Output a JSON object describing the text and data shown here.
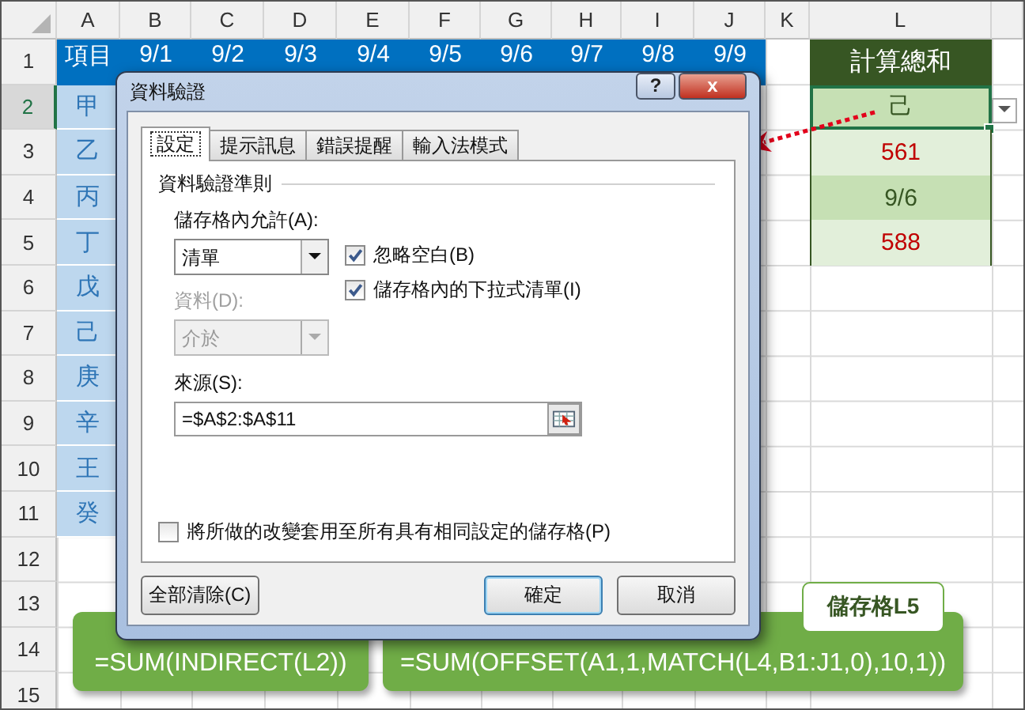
{
  "sheet": {
    "columns": [
      "A",
      "B",
      "C",
      "D",
      "E",
      "F",
      "G",
      "H",
      "I",
      "J",
      "K",
      "L"
    ],
    "rows": [
      {
        "number": "1",
        "cells": [
          {
            "text": "項目",
            "kind": "title"
          },
          {
            "text": "9/1",
            "kind": "title"
          },
          {
            "text": "9/2",
            "kind": "title"
          },
          {
            "text": "9/3",
            "kind": "title"
          },
          {
            "text": "9/4",
            "kind": "title"
          },
          {
            "text": "9/5",
            "kind": "title"
          },
          {
            "text": "9/6",
            "kind": "title"
          },
          {
            "text": "9/7",
            "kind": "title"
          },
          {
            "text": "9/8",
            "kind": "title"
          },
          {
            "text": "9/9",
            "kind": "title"
          },
          {
            "text": ""
          },
          {
            "text": "計算總和",
            "kind": "sum-title"
          }
        ]
      },
      {
        "number": "2",
        "selected": true,
        "cells": [
          {
            "text": "甲",
            "kind": "item"
          },
          {
            "text": ""
          },
          {
            "text": ""
          },
          {
            "text": ""
          },
          {
            "text": ""
          },
          {
            "text": ""
          },
          {
            "text": ""
          },
          {
            "text": ""
          },
          {
            "text": ""
          },
          {
            "text": ""
          },
          {
            "text": ""
          },
          {
            "text": "己",
            "kind": "result-dark",
            "selected": true
          }
        ]
      },
      {
        "number": "3",
        "cells": [
          {
            "text": "乙",
            "kind": "item"
          },
          {
            "text": ""
          },
          {
            "text": ""
          },
          {
            "text": ""
          },
          {
            "text": ""
          },
          {
            "text": ""
          },
          {
            "text": ""
          },
          {
            "text": ""
          },
          {
            "text": ""
          },
          {
            "text": ""
          },
          {
            "text": ""
          },
          {
            "text": "561",
            "kind": "result-red"
          }
        ]
      },
      {
        "number": "4",
        "cells": [
          {
            "text": "丙",
            "kind": "item"
          },
          {
            "text": ""
          },
          {
            "text": ""
          },
          {
            "text": ""
          },
          {
            "text": ""
          },
          {
            "text": ""
          },
          {
            "text": ""
          },
          {
            "text": ""
          },
          {
            "text": ""
          },
          {
            "text": ""
          },
          {
            "text": ""
          },
          {
            "text": "9/6",
            "kind": "result-dark"
          }
        ]
      },
      {
        "number": "5",
        "cells": [
          {
            "text": "丁",
            "kind": "item"
          },
          {
            "text": ""
          },
          {
            "text": ""
          },
          {
            "text": ""
          },
          {
            "text": ""
          },
          {
            "text": ""
          },
          {
            "text": ""
          },
          {
            "text": ""
          },
          {
            "text": ""
          },
          {
            "text": ""
          },
          {
            "text": ""
          },
          {
            "text": "588",
            "kind": "result-red"
          }
        ]
      },
      {
        "number": "6",
        "cells": [
          {
            "text": "戊",
            "kind": "item"
          }
        ]
      },
      {
        "number": "7",
        "cells": [
          {
            "text": "己",
            "kind": "item"
          }
        ]
      },
      {
        "number": "8",
        "cells": [
          {
            "text": "庚",
            "kind": "item"
          }
        ]
      },
      {
        "number": "9",
        "cells": [
          {
            "text": "辛",
            "kind": "item"
          }
        ]
      },
      {
        "number": "10",
        "cells": [
          {
            "text": "王",
            "kind": "item"
          }
        ]
      },
      {
        "number": "11",
        "cells": [
          {
            "text": "癸",
            "kind": "item"
          }
        ]
      },
      {
        "number": "12",
        "cells": []
      },
      {
        "number": "13",
        "cells": []
      },
      {
        "number": "14",
        "cells": []
      },
      {
        "number": "15",
        "cells": []
      }
    ]
  },
  "dialog": {
    "title": "資料驗證",
    "help_button": "?",
    "close_button": "x",
    "tabs": [
      {
        "label": "設定",
        "selected": true
      },
      {
        "label": "提示訊息",
        "selected": false
      },
      {
        "label": "錯誤提醒",
        "selected": false
      },
      {
        "label": "輸入法模式",
        "selected": false
      }
    ],
    "group_title": "資料驗證準則",
    "allow": {
      "label": "儲存格內允許(A):",
      "value": "清單",
      "disabled": false
    },
    "data": {
      "label": "資料(D):",
      "value": "介於",
      "disabled": true
    },
    "options": [
      {
        "label": "忽略空白(B)",
        "checked": true
      },
      {
        "label": "儲存格內的下拉式清單(I)",
        "checked": true
      }
    ],
    "source": {
      "label": "來源(S):",
      "value": "=$A$2:$A$11"
    },
    "apply_all": {
      "label": "將所做的改變套用至所有具有相同設定的儲存格(P)",
      "checked": false
    },
    "buttons": [
      {
        "label": "全部清除(C)",
        "default": false
      },
      {
        "label": "確定",
        "default": true
      },
      {
        "label": "取消",
        "default": false
      }
    ]
  },
  "callouts": [
    {
      "text": "=SUM(INDIRECT(L2))"
    },
    {
      "text": "=SUM(OFFSET(A1,1,MATCH(L4,B1:J1,0),10,1))"
    }
  ],
  "cell_label": "儲存格L5"
}
